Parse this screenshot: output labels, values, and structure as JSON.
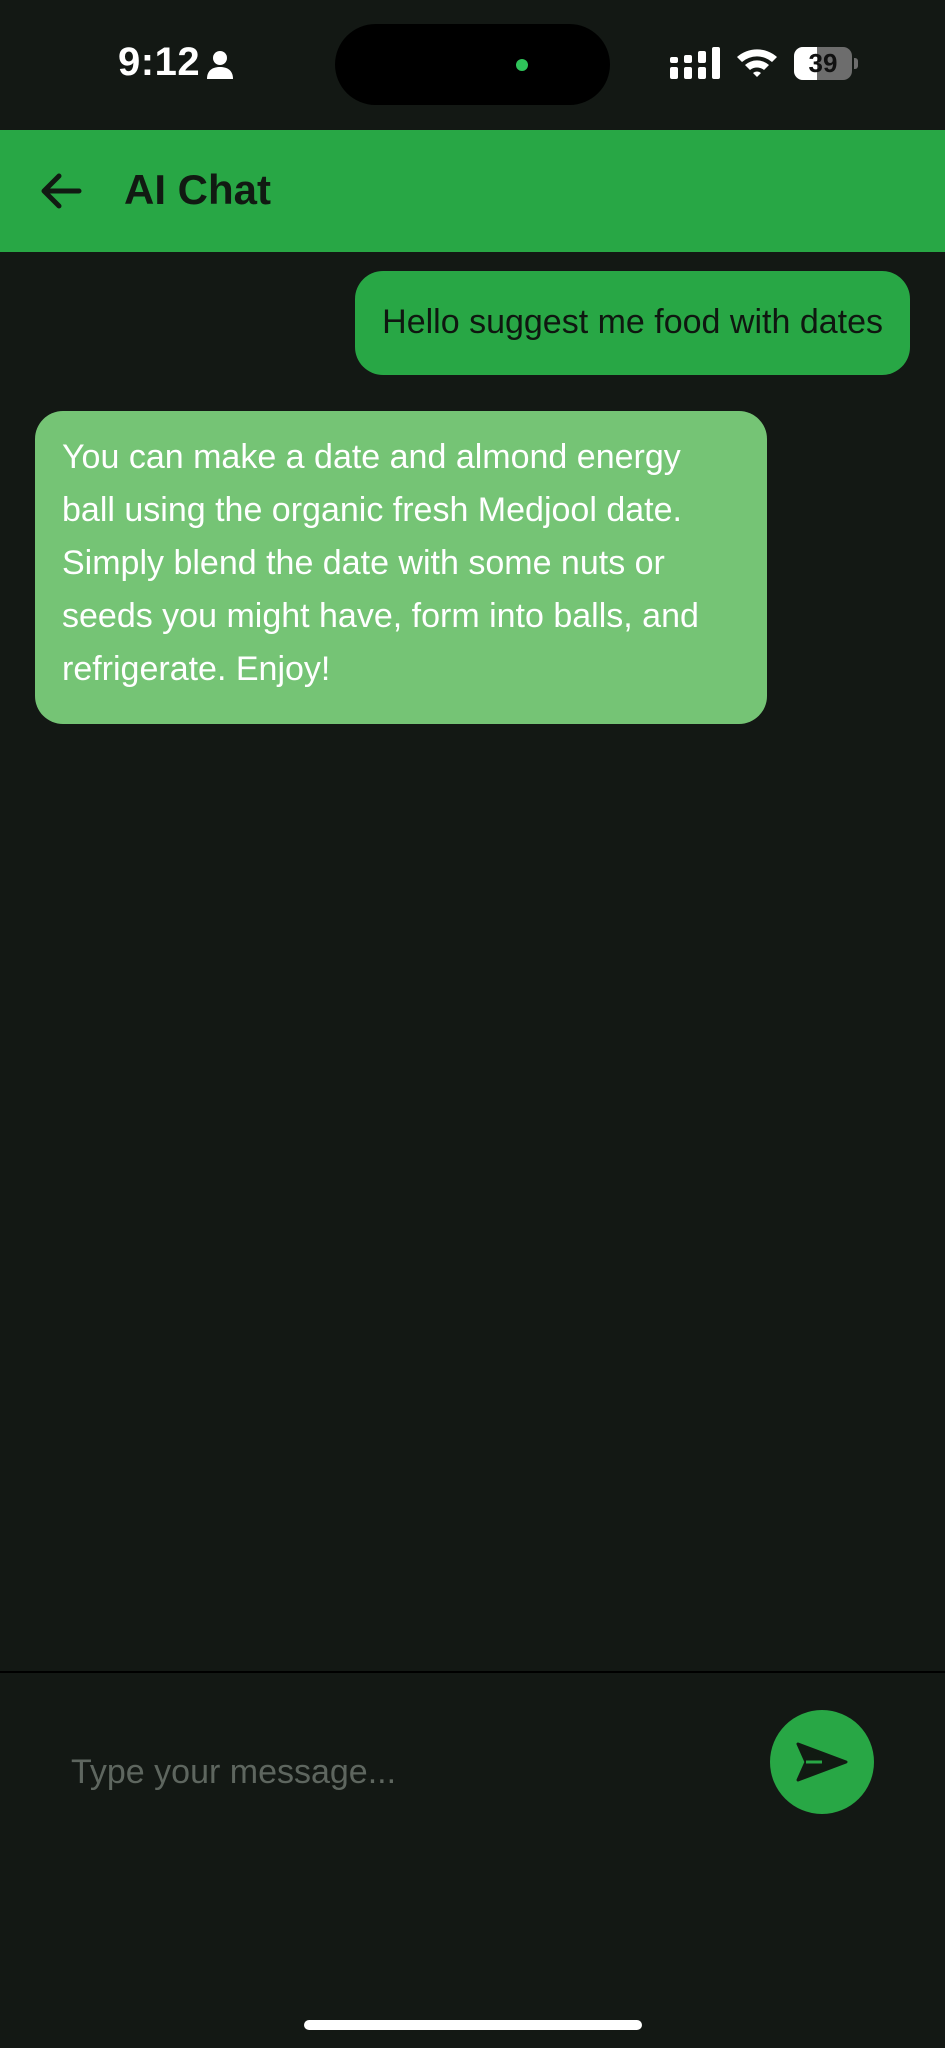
{
  "status_bar": {
    "time": "9:12",
    "battery_percent": "39",
    "battery_level": 0.39,
    "icons": [
      "person-icon",
      "cellular-signal-icon",
      "wifi-icon",
      "battery-icon"
    ]
  },
  "app_bar": {
    "back_icon": "arrow-left-icon",
    "title": "AI Chat"
  },
  "messages": [
    {
      "sender": "user",
      "text": "Hello suggest me food with dates"
    },
    {
      "sender": "ai",
      "text": "You can make a date and almond energy ball using the organic fresh Medjool date. Simply blend the date with some nuts or seeds you might have, form into balls, and refrigerate. Enjoy!"
    }
  ],
  "composer": {
    "placeholder": "Type your message...",
    "value": "",
    "send_icon": "send-icon"
  },
  "colors": {
    "background": "#131814",
    "accent": "#28a745",
    "ai_bubble": "#75c475"
  }
}
